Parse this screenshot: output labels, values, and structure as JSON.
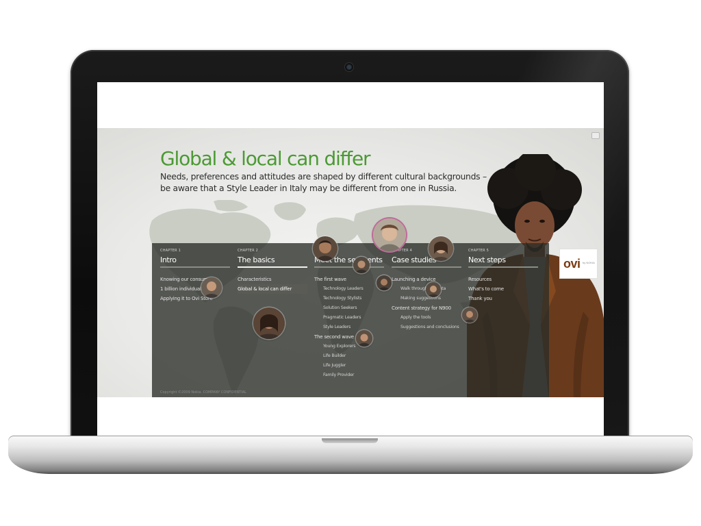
{
  "slide": {
    "title": "Global & local can differ",
    "subtitle_line1": "Needs, preferences and attitudes are shaped by different cultural backgrounds –",
    "subtitle_line2": "be aware that a Style Leader in Italy may be different from one in Russia."
  },
  "logo": {
    "text": "ovi",
    "small": "by NOKIA"
  },
  "chapters": [
    {
      "number": "CHAPTER 1",
      "title": "Intro",
      "active": false,
      "items": [
        {
          "label": "Knowing our consumers",
          "sub": false
        },
        {
          "label": "1 billion individuals",
          "sub": false
        },
        {
          "label": "Applying it to Ovi Store",
          "sub": false
        }
      ]
    },
    {
      "number": "CHAPTER 2",
      "title": "The basics",
      "active": true,
      "items": [
        {
          "label": "Characteristics",
          "sub": false
        },
        {
          "label": "Global & local can differ",
          "sub": false,
          "selected": true
        }
      ]
    },
    {
      "number": "CHAPTER 3",
      "title": "Meet the segments",
      "active": false,
      "items": [
        {
          "label": "The first wave",
          "sub": false
        },
        {
          "label": "Technology Leaders",
          "sub": true
        },
        {
          "label": "Technology Stylists",
          "sub": true
        },
        {
          "label": "Solution Seekers",
          "sub": true
        },
        {
          "label": "Pragmatic Leaders",
          "sub": true
        },
        {
          "label": "Style Leaders",
          "sub": true
        },
        {
          "label": "The second wave",
          "sub": false
        },
        {
          "label": "Young Explorers",
          "sub": true
        },
        {
          "label": "Life Builder",
          "sub": true
        },
        {
          "label": "Life Juggler",
          "sub": true
        },
        {
          "label": "Family Provider",
          "sub": true
        }
      ]
    },
    {
      "number": "CHAPTER 4",
      "title": "Case studies",
      "active": false,
      "items": [
        {
          "label": "Launching a device",
          "sub": false
        },
        {
          "label": "Walk through the data",
          "sub": true
        },
        {
          "label": "Making suggestions",
          "sub": true
        },
        {
          "label": "Content strategy for N900",
          "sub": false
        },
        {
          "label": "Apply the tools",
          "sub": true
        },
        {
          "label": "Suggestions and conclusions",
          "sub": true
        }
      ]
    },
    {
      "number": "CHAPTER 5",
      "title": "Next steps",
      "active": false,
      "items": [
        {
          "label": "Resources",
          "sub": false
        },
        {
          "label": "What's to come",
          "sub": false
        },
        {
          "label": "Thank you",
          "sub": false
        }
      ]
    }
  ],
  "footer": {
    "copyright": "Copyright ©2009 Nokia. COMPANY CONFIDENTIAL"
  },
  "colors": {
    "title_green": "#4b9a33",
    "panel": "#2a2d28",
    "logo_brown": "#7a3a12"
  }
}
